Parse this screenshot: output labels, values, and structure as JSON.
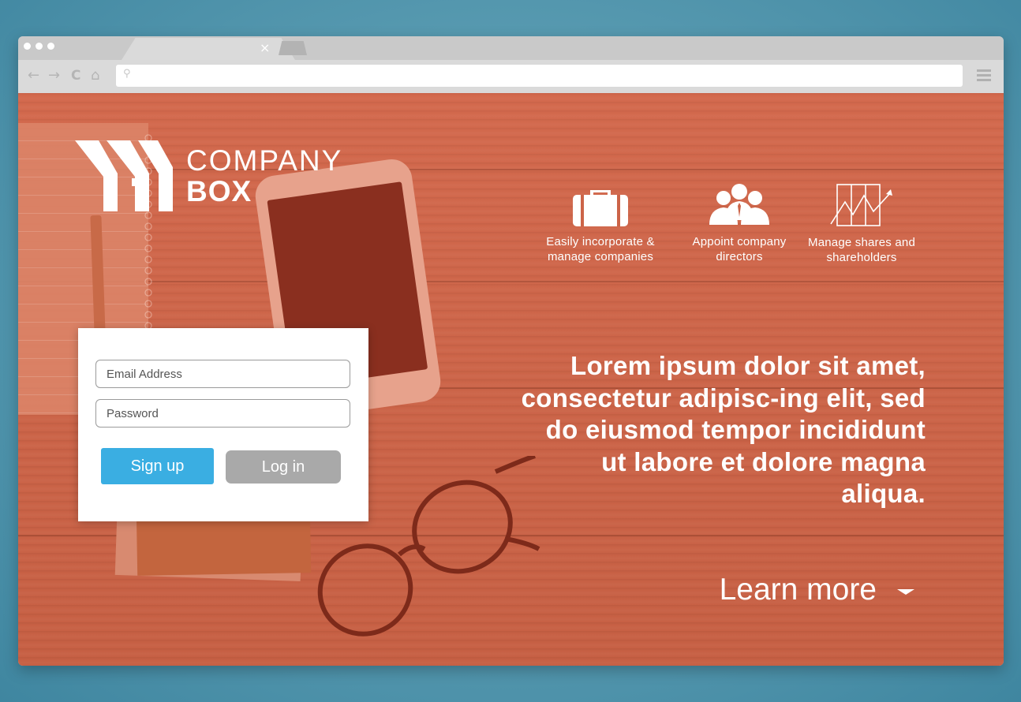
{
  "browser": {
    "tab_close": "×",
    "nav": {
      "back": "←",
      "forward": "→",
      "reload": "C",
      "home": "⌂"
    },
    "search_glyph": "⚲"
  },
  "brand": {
    "line1": "COMPANY",
    "line2": "BOX"
  },
  "features": [
    {
      "icon": "briefcase-icon",
      "text": "Easily incorporate & manage companies"
    },
    {
      "icon": "people-icon",
      "text": "Appoint company directors"
    },
    {
      "icon": "growth-chart-icon",
      "text": "Manage shares and shareholders"
    }
  ],
  "login": {
    "email_placeholder": "Email Address",
    "password_placeholder": "Password",
    "signup_label": "Sign up",
    "login_label": "Log in"
  },
  "hero": {
    "text": "Lorem ipsum dolor sit amet, consectetur adipisc-ing elit, sed do eiusmod tempor incididunt ut labore et dolore magna aliqua.",
    "learn_more": "Learn more"
  },
  "colors": {
    "overlay": "#cc6448",
    "signup": "#3aaee2",
    "login": "#a9a9a9",
    "backdrop": "#5a9cb2"
  }
}
